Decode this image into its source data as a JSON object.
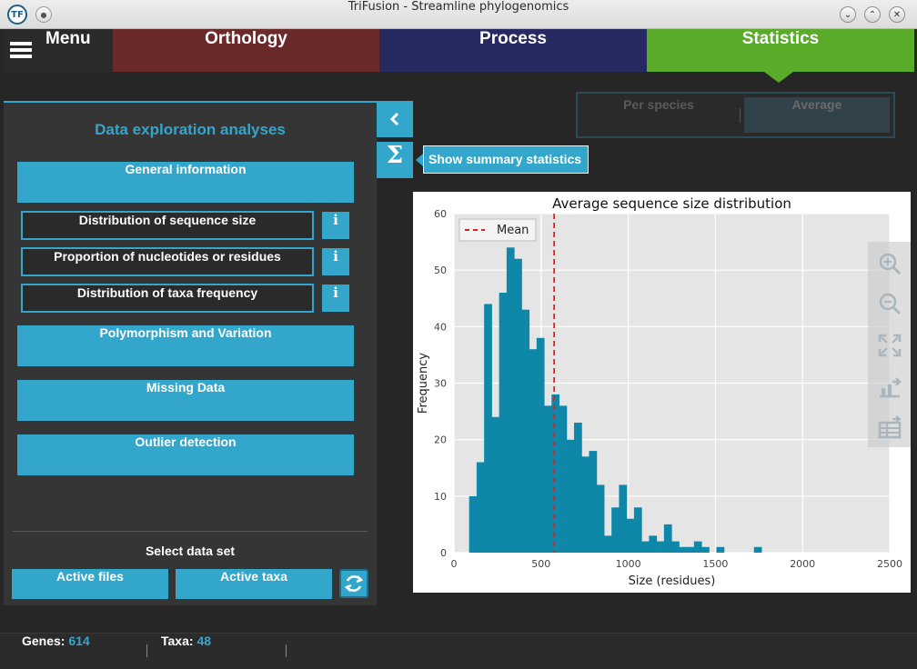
{
  "window": {
    "title": "TriFusion - Streamline phylogenomics",
    "app_icon_text": "TF"
  },
  "nav": {
    "menu_label": "Menu",
    "tabs": [
      {
        "label": "Orthology",
        "color": "#6b2a2a"
      },
      {
        "label": "Process",
        "color": "#262a60"
      },
      {
        "label": "Statistics",
        "color": "#5aab2a",
        "active": true
      }
    ]
  },
  "side_panel": {
    "title": "Data exploration analyses",
    "sections": [
      {
        "label": "General information",
        "expanded": true
      },
      {
        "label": "Polymorphism and Variation"
      },
      {
        "label": "Missing Data"
      },
      {
        "label": "Outlier detection"
      }
    ],
    "general_items": [
      {
        "label": "Distribution of sequence size",
        "info": "i"
      },
      {
        "label": "Proportion of nucleotides or residues",
        "info": "i"
      },
      {
        "label": "Distribution of taxa frequency",
        "info": "i"
      }
    ],
    "dataset_label": "Select data set",
    "dataset_buttons": [
      "Active files",
      "Active taxa"
    ],
    "accent_color": "#33a6cc"
  },
  "summary": {
    "sigma_glyph": "Σ",
    "tooltip": "Show summary statistics"
  },
  "view_switch": {
    "options": [
      "Per species",
      "Average"
    ],
    "selected": "Average"
  },
  "plot_toolbar": {
    "icons": [
      "zoom-in-icon",
      "zoom-out-icon",
      "fit-screen-icon",
      "export-figure-icon",
      "export-table-icon"
    ]
  },
  "status": {
    "genes_label": "Genes:",
    "genes_value": "614",
    "taxa_label": "Taxa:",
    "taxa_value": "48"
  },
  "chart_data": {
    "type": "bar",
    "title": "Average sequence size distribution",
    "xlabel": "Size (residues)",
    "ylabel": "Frequency",
    "xlim": [
      0,
      2500
    ],
    "ylim": [
      0,
      60
    ],
    "x_ticks": [
      0,
      500,
      1000,
      1500,
      2000,
      2500
    ],
    "y_ticks": [
      0,
      10,
      20,
      30,
      40,
      50,
      60
    ],
    "grid": true,
    "bar_color": "#0f87a8",
    "mean_line": {
      "label": "Mean",
      "x": 575,
      "color": "#e02020",
      "style": "dashed"
    },
    "legend_position": "top-left",
    "bin_width": 43,
    "bins": [
      {
        "x": 87,
        "y": 10
      },
      {
        "x": 130,
        "y": 16
      },
      {
        "x": 173,
        "y": 44
      },
      {
        "x": 216,
        "y": 24
      },
      {
        "x": 259,
        "y": 46
      },
      {
        "x": 302,
        "y": 54
      },
      {
        "x": 345,
        "y": 52
      },
      {
        "x": 388,
        "y": 43
      },
      {
        "x": 431,
        "y": 36
      },
      {
        "x": 474,
        "y": 38
      },
      {
        "x": 517,
        "y": 26
      },
      {
        "x": 560,
        "y": 28
      },
      {
        "x": 603,
        "y": 26
      },
      {
        "x": 646,
        "y": 20
      },
      {
        "x": 689,
        "y": 23
      },
      {
        "x": 732,
        "y": 17
      },
      {
        "x": 775,
        "y": 18
      },
      {
        "x": 818,
        "y": 12
      },
      {
        "x": 861,
        "y": 3
      },
      {
        "x": 904,
        "y": 8
      },
      {
        "x": 947,
        "y": 12
      },
      {
        "x": 990,
        "y": 6
      },
      {
        "x": 1033,
        "y": 8
      },
      {
        "x": 1076,
        "y": 2
      },
      {
        "x": 1119,
        "y": 3
      },
      {
        "x": 1162,
        "y": 2
      },
      {
        "x": 1205,
        "y": 5
      },
      {
        "x": 1248,
        "y": 2
      },
      {
        "x": 1291,
        "y": 1
      },
      {
        "x": 1334,
        "y": 1
      },
      {
        "x": 1377,
        "y": 2
      },
      {
        "x": 1420,
        "y": 1
      },
      {
        "x": 1506,
        "y": 1
      },
      {
        "x": 1721,
        "y": 1
      }
    ]
  }
}
